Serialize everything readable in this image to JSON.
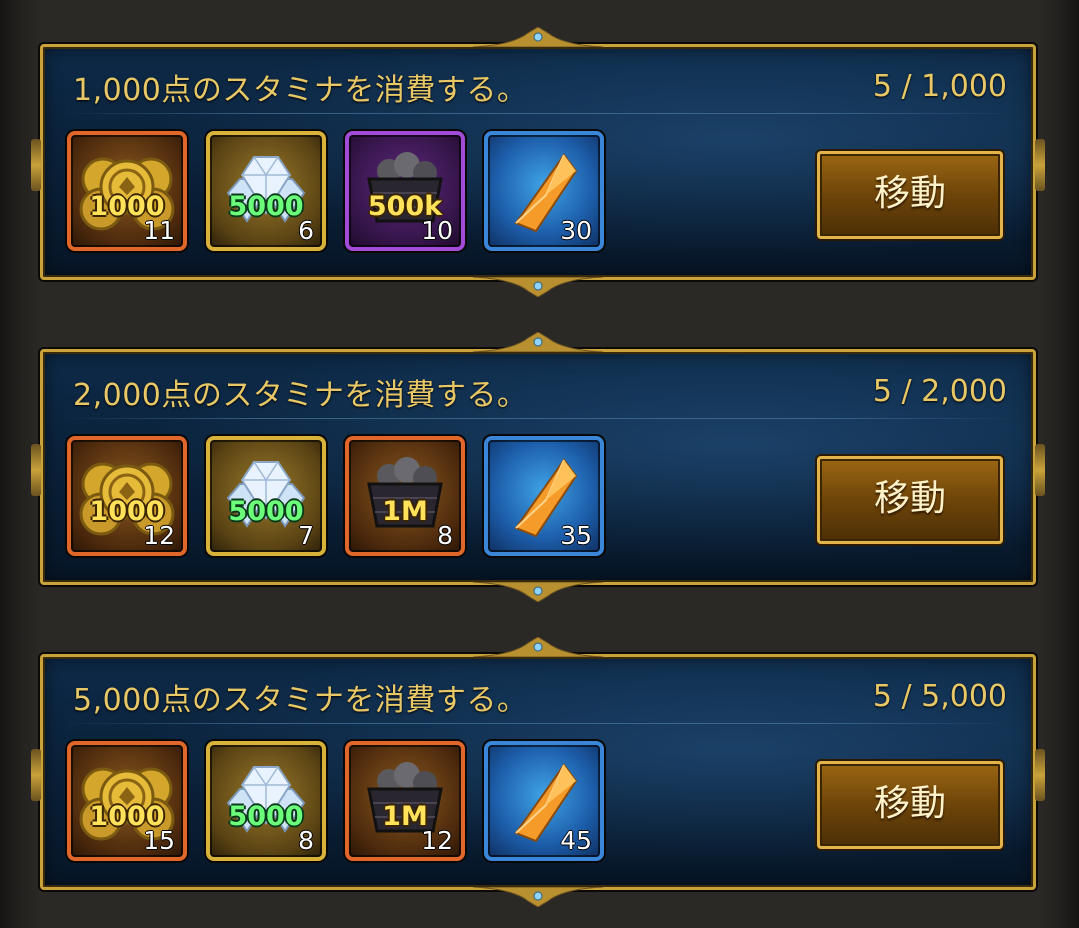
{
  "quests": [
    {
      "title": "1,000点のスタミナを消費する。",
      "progress": "5 / 1,000",
      "button_label": "移動",
      "rewards": [
        {
          "icon": "gold-coins-icon",
          "frame": "orange",
          "badge": "1000",
          "count": "11"
        },
        {
          "icon": "diamonds-icon",
          "frame": "gold",
          "badge": "5000",
          "count": "6"
        },
        {
          "icon": "ore-cart-icon",
          "frame": "purple",
          "badge": "500k",
          "count": "10"
        },
        {
          "icon": "orange-crystal-icon",
          "frame": "blue",
          "badge": "",
          "count": "30"
        }
      ]
    },
    {
      "title": "2,000点のスタミナを消費する。",
      "progress": "5 / 2,000",
      "button_label": "移動",
      "rewards": [
        {
          "icon": "gold-coins-icon",
          "frame": "orange",
          "badge": "1000",
          "count": "12"
        },
        {
          "icon": "diamonds-icon",
          "frame": "gold",
          "badge": "5000",
          "count": "7"
        },
        {
          "icon": "ore-cart-icon",
          "frame": "orange",
          "badge": "1M",
          "count": "8"
        },
        {
          "icon": "orange-crystal-icon",
          "frame": "blue",
          "badge": "",
          "count": "35"
        }
      ]
    },
    {
      "title": "5,000点のスタミナを消費する。",
      "progress": "5 / 5,000",
      "button_label": "移動",
      "rewards": [
        {
          "icon": "gold-coins-icon",
          "frame": "orange",
          "badge": "1000",
          "count": "15"
        },
        {
          "icon": "diamonds-icon",
          "frame": "gold",
          "badge": "5000",
          "count": "8"
        },
        {
          "icon": "ore-cart-icon",
          "frame": "orange",
          "badge": "1M",
          "count": "12"
        },
        {
          "icon": "orange-crystal-icon",
          "frame": "blue",
          "badge": "",
          "count": "45"
        }
      ]
    }
  ],
  "colors": {
    "gold_text": "#e8c766",
    "panel_border": "#c9a23a",
    "frame_orange": "#e0662a",
    "frame_gold": "#d9b23a",
    "frame_purple": "#a24bd8",
    "frame_blue": "#3a86d8"
  }
}
